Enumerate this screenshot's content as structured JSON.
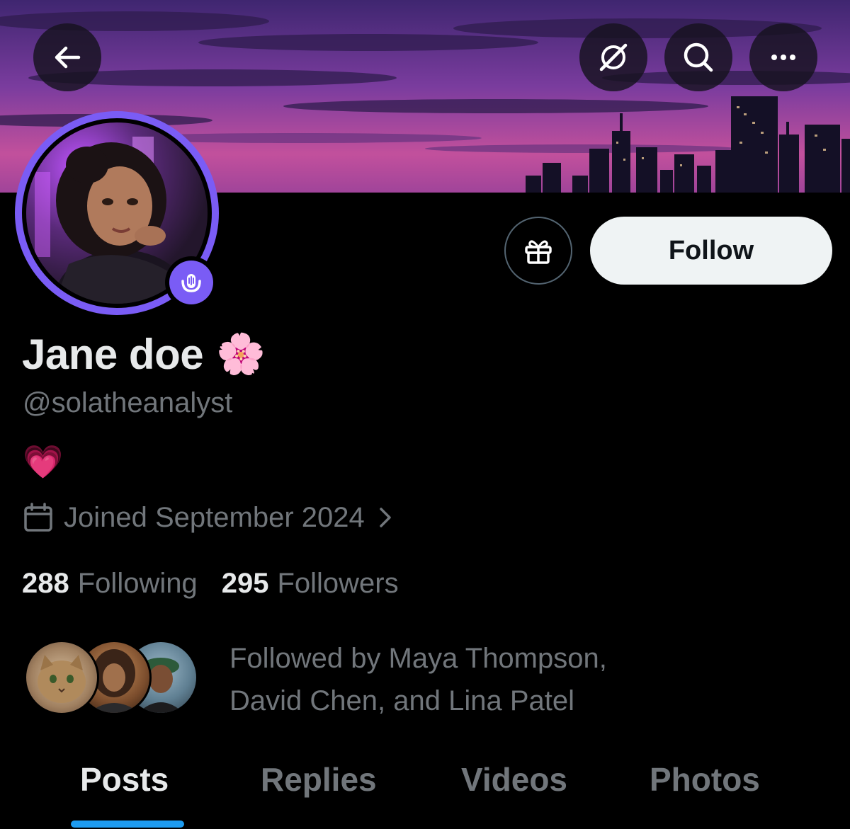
{
  "header": {
    "back_icon": "back-arrow-icon",
    "grok_icon": "grok-slash-icon",
    "search_icon": "search-icon",
    "more_icon": "more-dots-icon"
  },
  "profile": {
    "display_name": "Jane doe",
    "name_emoji": "🌸",
    "handle": "@solatheanalyst",
    "bio": "💗",
    "joined": "Joined September 2024",
    "following_count": "288",
    "following_label": "Following",
    "followers_count": "295",
    "followers_label": "Followers",
    "followed_by_line1": "Followed by Maya Thompson,",
    "followed_by_line2": "David Chen, and Lina Patel",
    "accent_color": "#7a5cf5"
  },
  "actions": {
    "follow_label": "Follow",
    "gift_icon": "gift-icon"
  },
  "tabs": [
    {
      "label": "Posts",
      "active": true
    },
    {
      "label": "Replies",
      "active": false
    },
    {
      "label": "Videos",
      "active": false
    },
    {
      "label": "Photos",
      "active": false
    }
  ],
  "colors": {
    "background": "#000000",
    "primary_text": "#e7e9ea",
    "secondary_text": "#71767b",
    "tab_indicator": "#1d9bf0"
  }
}
